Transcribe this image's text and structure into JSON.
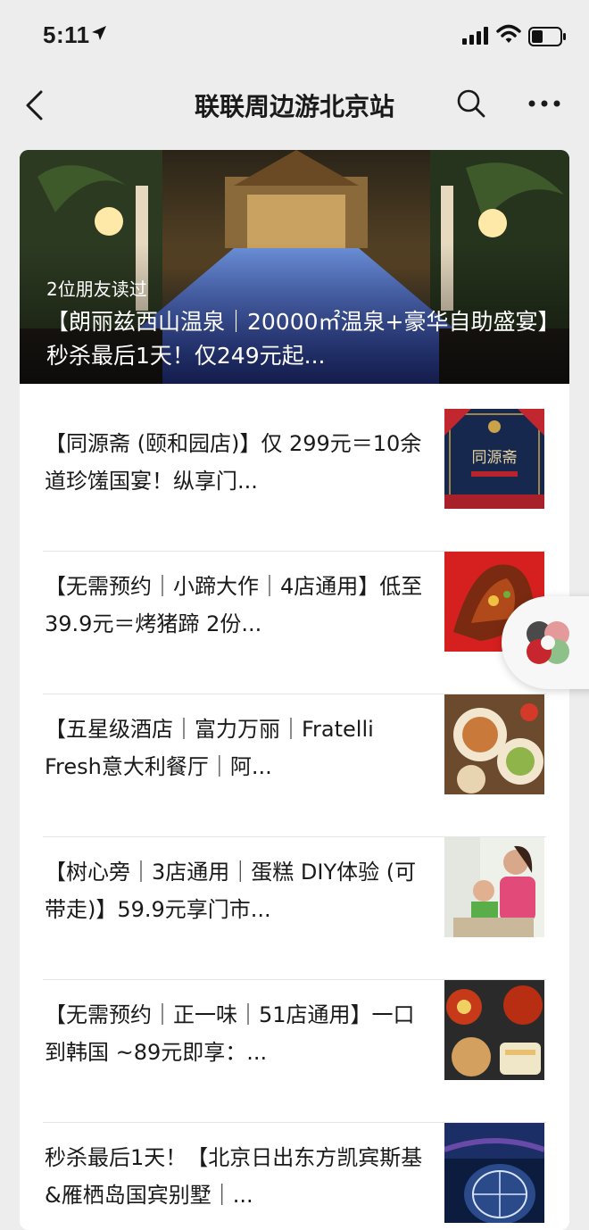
{
  "status_bar": {
    "time": "5:11"
  },
  "nav": {
    "title": "联联周边游北京站"
  },
  "hero": {
    "readers": "2位朋友读过",
    "title": "【朗丽兹西山温泉｜20000㎡温泉+豪华自助盛宴】秒杀最后1天！仅249元起..."
  },
  "articles": [
    {
      "title": "【同源斋 (颐和园店)】仅 299元＝10余道珍馐国宴！纵享门...",
      "thumb": "tongyuanzhai",
      "thumb_text": "同源斋"
    },
    {
      "title": "【无需预约｜小蹄大作｜4店通用】低至 39.9元＝烤猪蹄 2份...",
      "thumb": "roast-trotters"
    },
    {
      "title": "【五星级酒店｜富力万丽｜Fratelli Fresh意大利餐厅｜阿...",
      "thumb": "italian-food"
    },
    {
      "title": "【树心旁｜3店通用｜蛋糕 DIY体验 (可带走)】59.9元享门市...",
      "thumb": "cake-diy"
    },
    {
      "title": "【无需预约｜正一味｜51店通用】一口到韩国 ~89元即享：...",
      "thumb": "korean-food"
    },
    {
      "title": "秒杀最后1天！【北京日出东方凯宾斯基&雁栖岛国宾别墅｜...",
      "thumb": "hotel-night"
    }
  ]
}
